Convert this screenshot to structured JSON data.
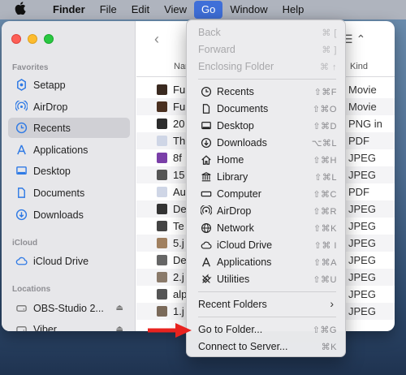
{
  "menubar": {
    "apple_icon": "apple-logo-icon",
    "items": [
      "Finder",
      "File",
      "Edit",
      "View",
      "Go",
      "Window",
      "Help"
    ],
    "active": "Go"
  },
  "sidebar": {
    "favorites_label": "Favorites",
    "favorites": [
      {
        "label": "Setapp",
        "icon": "setapp-icon"
      },
      {
        "label": "AirDrop",
        "icon": "airdrop-icon"
      },
      {
        "label": "Recents",
        "icon": "clock-icon",
        "selected": true
      },
      {
        "label": "Applications",
        "icon": "applications-icon"
      },
      {
        "label": "Desktop",
        "icon": "desktop-icon"
      },
      {
        "label": "Documents",
        "icon": "document-icon"
      },
      {
        "label": "Downloads",
        "icon": "download-icon"
      }
    ],
    "icloud_label": "iCloud",
    "icloud": [
      {
        "label": "iCloud Drive",
        "icon": "cloud-icon"
      }
    ],
    "locations_label": "Locations",
    "locations": [
      {
        "label": "OBS-Studio 2...",
        "icon": "disk-icon",
        "eject": "⏏"
      },
      {
        "label": "Viber",
        "icon": "disk-icon",
        "eject": "⏏"
      }
    ]
  },
  "file_list": {
    "columns": {
      "name": "Nar",
      "kind": "Kind"
    },
    "rows": [
      {
        "name": "Fu",
        "kind": "Movie",
        "color": "#3a2a20"
      },
      {
        "name": "Fu",
        "kind": "Movie",
        "color": "#4a3020"
      },
      {
        "name": "20",
        "kind": "PNG in",
        "color": "#2c2c2c"
      },
      {
        "name": "Th",
        "kind": "PDF",
        "color": "#cfd6e6"
      },
      {
        "name": "8f",
        "kind": "JPEG",
        "color": "#7a3fa8"
      },
      {
        "name": "15",
        "kind": "JPEG",
        "color": "#555555"
      },
      {
        "name": "Au",
        "kind": "PDF",
        "color": "#cfd6e6"
      },
      {
        "name": "De",
        "kind": "JPEG",
        "color": "#333333"
      },
      {
        "name": "Te",
        "kind": "JPEG",
        "color": "#444444"
      },
      {
        "name": "5.j",
        "kind": "JPEG",
        "color": "#a08060"
      },
      {
        "name": "De",
        "kind": "JPEG",
        "color": "#666666"
      },
      {
        "name": "2.j",
        "kind": "JPEG",
        "color": "#8a7a6a"
      },
      {
        "name": "alp",
        "kind": "JPEG",
        "color": "#555555"
      },
      {
        "name": "1.j",
        "kind": "JPEG",
        "color": "#7a6a5a"
      }
    ]
  },
  "go_menu": {
    "items": [
      {
        "label": "Back",
        "shortcut": "⌘ [",
        "disabled": true
      },
      {
        "label": "Forward",
        "shortcut": "⌘ ]",
        "disabled": true
      },
      {
        "label": "Enclosing Folder",
        "shortcut": "⌘ ↑",
        "disabled": true
      },
      {
        "separator": true
      },
      {
        "label": "Recents",
        "shortcut": "⇧⌘F",
        "icon": "clock-icon"
      },
      {
        "label": "Documents",
        "shortcut": "⇧⌘O",
        "icon": "document-icon"
      },
      {
        "label": "Desktop",
        "shortcut": "⇧⌘D",
        "icon": "desktop-icon"
      },
      {
        "label": "Downloads",
        "shortcut": "⌥⌘L",
        "icon": "download-icon"
      },
      {
        "label": "Home",
        "shortcut": "⇧⌘H",
        "icon": "home-icon"
      },
      {
        "label": "Library",
        "shortcut": "⇧⌘L",
        "icon": "library-icon"
      },
      {
        "label": "Computer",
        "shortcut": "⇧⌘C",
        "icon": "computer-icon"
      },
      {
        "label": "AirDrop",
        "shortcut": "⇧⌘R",
        "icon": "airdrop-icon"
      },
      {
        "label": "Network",
        "shortcut": "⇧⌘K",
        "icon": "network-icon"
      },
      {
        "label": "iCloud Drive",
        "shortcut": "⇧⌘ I",
        "icon": "cloud-icon"
      },
      {
        "label": "Applications",
        "shortcut": "⇧⌘A",
        "icon": "applications-icon"
      },
      {
        "label": "Utilities",
        "shortcut": "⇧⌘U",
        "icon": "utilities-icon"
      },
      {
        "separator": true
      },
      {
        "label": "Recent Folders",
        "submenu": "›"
      },
      {
        "separator": true
      },
      {
        "label": "Go to Folder...",
        "shortcut": "⇧⌘G"
      },
      {
        "label": "Connect to Server...",
        "shortcut": "⌘K"
      }
    ]
  },
  "annotation": {
    "arrow_color": "#e8231f",
    "points_to": "Go to Folder..."
  }
}
